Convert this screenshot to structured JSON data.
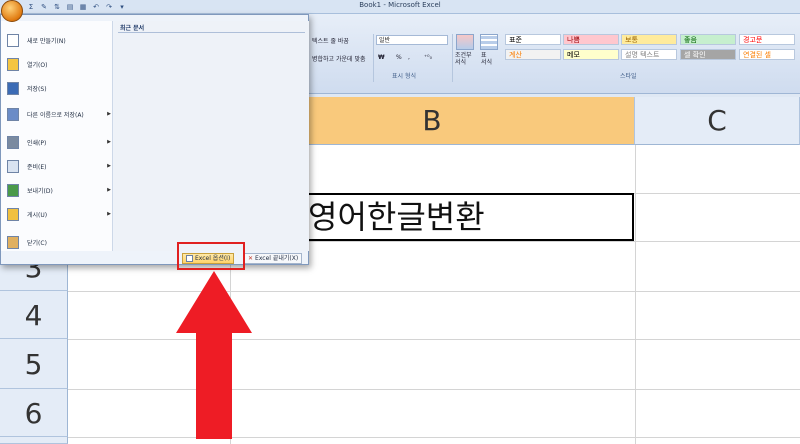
{
  "window": {
    "title": "Book1 - Microsoft Excel"
  },
  "ribbon": {
    "wrap_text": "텍스트 줄 바꿈",
    "merge_center": "병합하고 가운데 맞춤",
    "number_format": "일반",
    "currency": "₩",
    "percent": "%",
    "comma": ",",
    "number_group_label": "표시 형식",
    "cond_format": "조건부 서식",
    "table_format": "표 서식",
    "styles_group_label": "스타일",
    "cell_styles": [
      {
        "label": "표준",
        "color": "#000000",
        "bg": "#ffffff"
      },
      {
        "label": "나쁨",
        "color": "#9c0006",
        "bg": "#ffc7ce"
      },
      {
        "label": "보통",
        "color": "#9c6500",
        "bg": "#ffeb9c"
      },
      {
        "label": "좋음",
        "color": "#006100",
        "bg": "#c6efce"
      },
      {
        "label": "경고문",
        "color": "#ff0000",
        "bg": "#ffffff"
      },
      {
        "label": "계산",
        "color": "#fa7d00",
        "bg": "#f2f2f2"
      },
      {
        "label": "메모",
        "color": "#000000",
        "bg": "#ffffcc"
      },
      {
        "label": "설명 텍스트",
        "color": "#7f7f7f",
        "bg": "#ffffff"
      },
      {
        "label": "셀 확인",
        "color": "#ffffff",
        "bg": "#a5a5a5"
      },
      {
        "label": "연결된 셀",
        "color": "#fa7d00",
        "bg": "#ffffff"
      }
    ]
  },
  "sheet": {
    "columns": [
      "B",
      "C"
    ],
    "rows": [
      "3",
      "4",
      "5",
      "6"
    ],
    "cell_value": "영어한글변환"
  },
  "office_menu": {
    "recent_title": "최근 문서",
    "items": [
      {
        "label": "새로 만들기(N)",
        "icon": "new-document-icon",
        "submenu": false
      },
      {
        "label": "열기(O)",
        "icon": "open-folder-icon",
        "submenu": false
      },
      {
        "label": "저장(S)",
        "icon": "save-disk-icon",
        "submenu": false
      },
      {
        "label": "다른 이름으로 저장(A)",
        "icon": "save-as-icon",
        "submenu": true
      },
      {
        "label": "인쇄(P)",
        "icon": "printer-icon",
        "submenu": true
      },
      {
        "label": "준비(E)",
        "icon": "prepare-icon",
        "submenu": true
      },
      {
        "label": "보내기(D)",
        "icon": "send-icon",
        "submenu": true
      },
      {
        "label": "게시(U)",
        "icon": "publish-icon",
        "submenu": true
      },
      {
        "label": "닫기(C)",
        "icon": "close-folder-icon",
        "submenu": false
      }
    ],
    "options_button": "Excel 옵션(I)",
    "exit_button": "Excel 끝내기(X)"
  },
  "colors": {
    "accent_red": "#e02020",
    "selected_column": "#f9c97c"
  }
}
